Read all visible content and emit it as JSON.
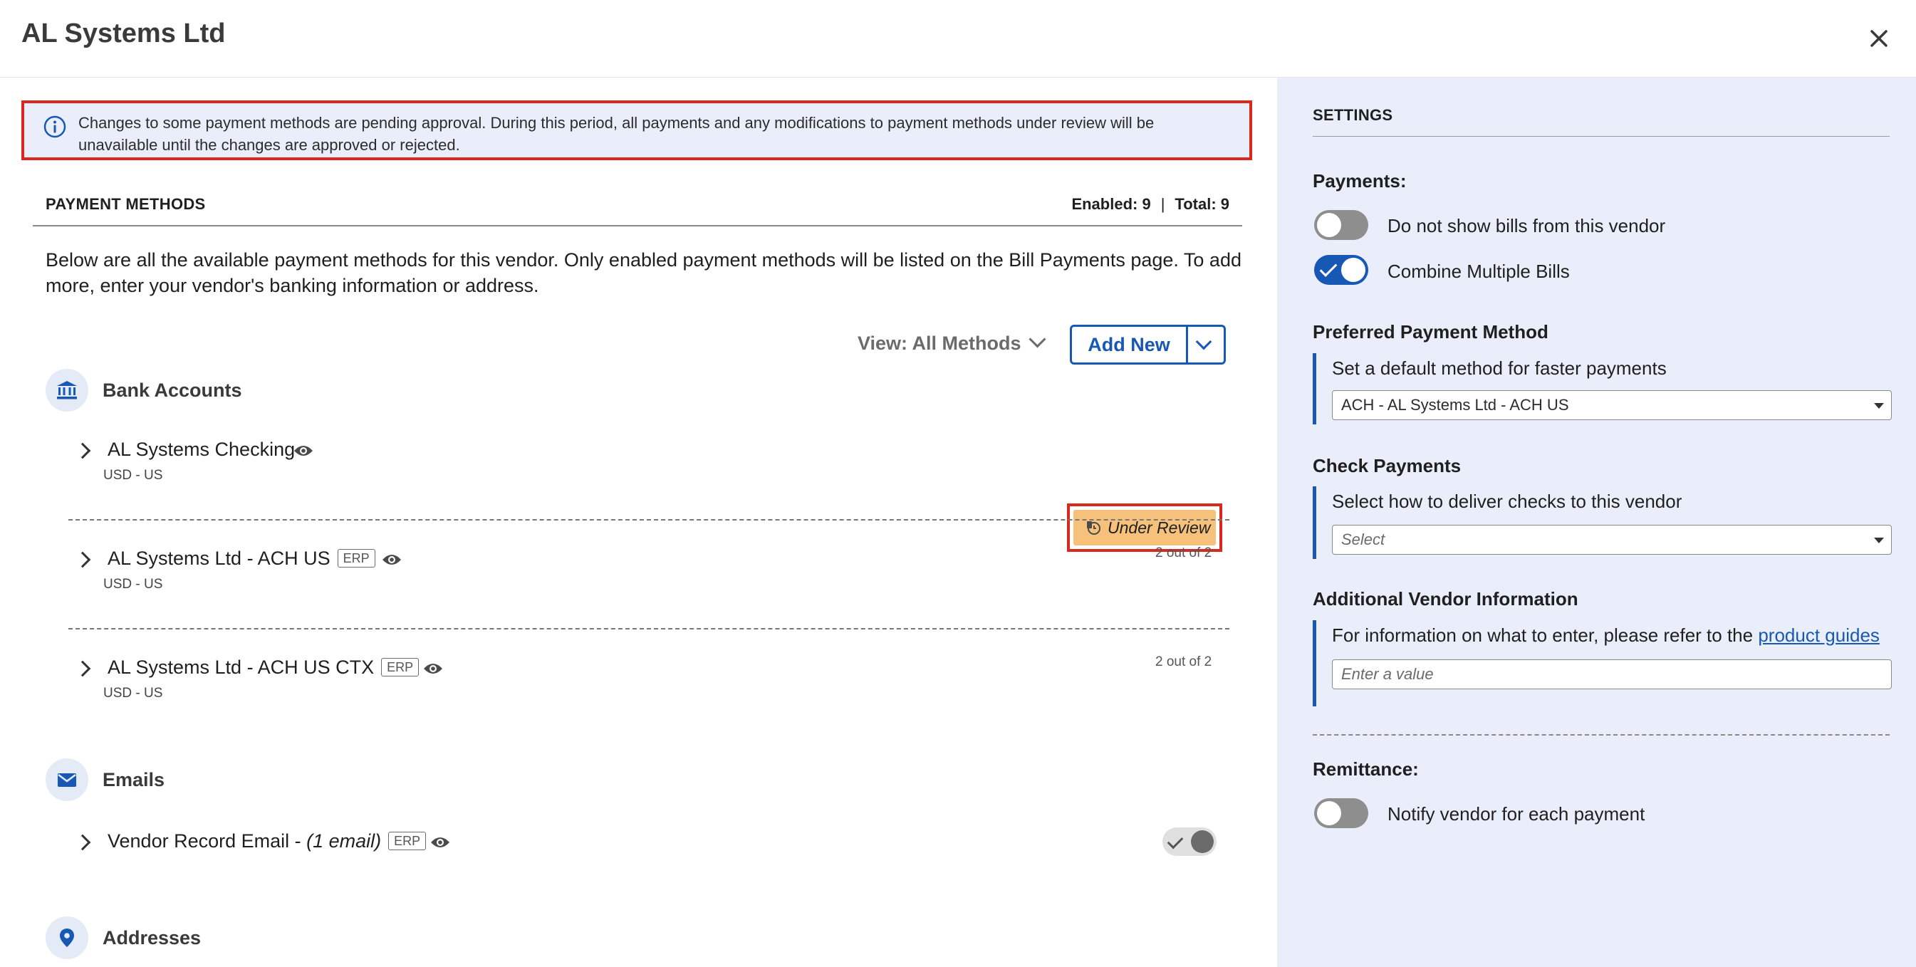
{
  "header": {
    "title": "AL Systems Ltd"
  },
  "alert": {
    "text": "Changes to some payment methods are pending approval. During this period, all payments and any modifications to payment methods under review will be unavailable until the changes are approved or rejected."
  },
  "payment_methods": {
    "heading": "PAYMENT METHODS",
    "enabled": "Enabled: 9",
    "separator": "|",
    "total": "Total: 9",
    "description": "Below are all the available payment methods for this vendor. Only enabled payment methods will be listed on the Bill Payments page. To add more, enter your vendor's banking information or address.",
    "view_label": "View: All Methods",
    "add_new_label": "Add New"
  },
  "sections": {
    "bank_accounts": {
      "title": "Bank Accounts",
      "items": [
        {
          "name": "AL Systems Checking",
          "sub": "USD - US",
          "badge": "Under Review"
        },
        {
          "name": "AL Systems Ltd - ACH US",
          "erp": "ERP",
          "sub": "USD - US",
          "count": "2 out of 2"
        },
        {
          "name": "AL Systems Ltd - ACH US CTX",
          "erp": "ERP",
          "sub": "USD - US",
          "count": "2 out of 2"
        }
      ]
    },
    "emails": {
      "title": "Emails",
      "items": [
        {
          "name": "Vendor Record Email - ",
          "name_em": "(1 email)",
          "erp": "ERP"
        }
      ]
    },
    "addresses": {
      "title": "Addresses"
    }
  },
  "settings": {
    "title": "SETTINGS",
    "payments_label": "Payments:",
    "toggle_hide_bills": "Do not show bills from this vendor",
    "toggle_combine": "Combine Multiple Bills",
    "preferred_label": "Preferred Payment Method",
    "preferred_help": "Set a default method for faster payments",
    "preferred_value": "ACH - AL Systems Ltd - ACH US",
    "check_label": "Check Payments",
    "check_help": "Select how to deliver checks to this vendor",
    "check_placeholder": "Select",
    "additional_label": "Additional Vendor Information",
    "additional_help": "For information on what to enter, please refer to the ",
    "additional_link": "product guides",
    "additional_placeholder": "Enter a value",
    "remittance_label": "Remittance:",
    "toggle_notify": "Notify vendor for each payment"
  }
}
